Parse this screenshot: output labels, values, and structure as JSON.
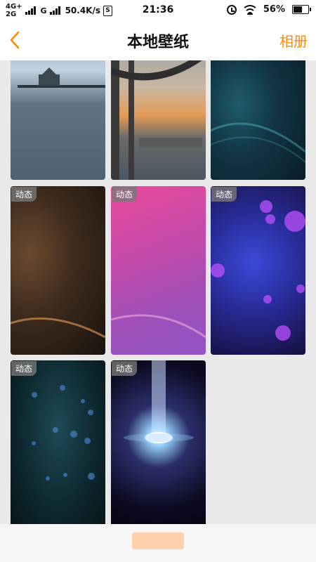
{
  "status": {
    "network_top": "4G+",
    "network_bottom": "2G",
    "carrier2": "G",
    "speed": "50.4K/s",
    "sim_label": "S",
    "time": "21:36",
    "battery": "56%",
    "battery_level": 0.56
  },
  "nav": {
    "back_icon": "chevron-left-icon",
    "title": "本地壁纸",
    "album_label": "相册"
  },
  "colors": {
    "accent": "#ff8a00",
    "background": "#e9e9e9"
  },
  "wallpapers": [
    {
      "label": "",
      "dynamic": false
    },
    {
      "label": "",
      "dynamic": false
    },
    {
      "label": "",
      "dynamic": false
    },
    {
      "label": "动态",
      "dynamic": true
    },
    {
      "label": "动态",
      "dynamic": true
    },
    {
      "label": "动态",
      "dynamic": true
    },
    {
      "label": "动态",
      "dynamic": true
    },
    {
      "label": "动态",
      "dynamic": true
    }
  ]
}
